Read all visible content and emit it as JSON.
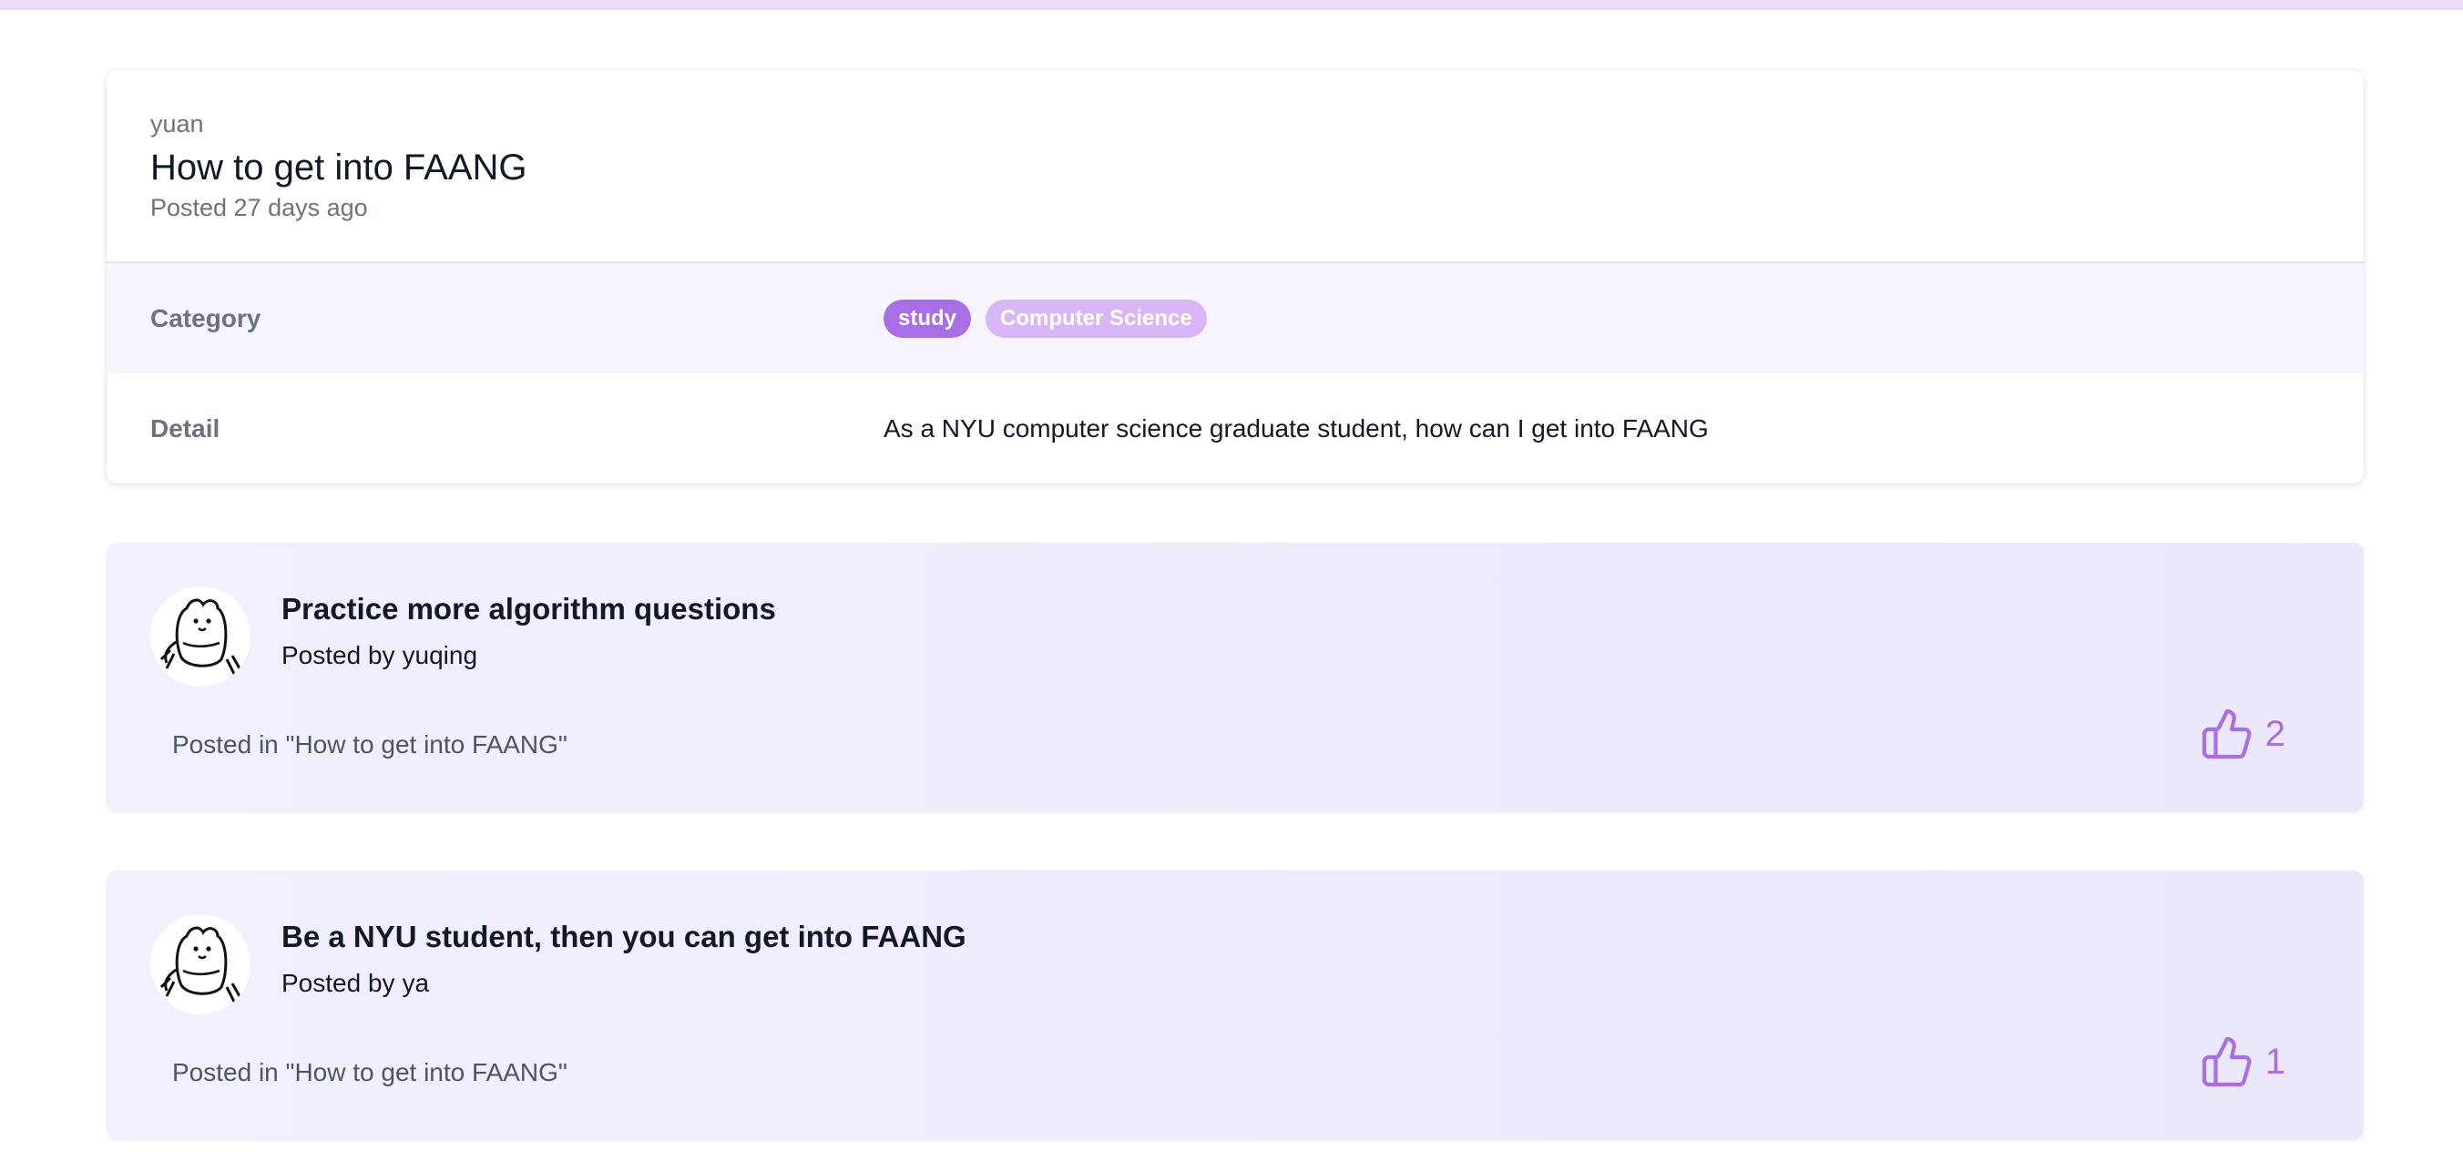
{
  "post": {
    "author": "yuan",
    "title": "How to get into FAANG",
    "posted": "Posted 27 days ago",
    "category_label": "Category",
    "tags": [
      "study",
      "Computer Science"
    ],
    "detail_label": "Detail",
    "detail": "As a NYU computer science graduate student, how can I get into FAANG"
  },
  "comments": [
    {
      "title": "Practice more algorithm questions",
      "by_label": "Posted by",
      "author": "yuqing",
      "posted_in": "Posted in \"How to get into FAANG\"",
      "likes": "2"
    },
    {
      "title": "Be a NYU student, then you can get into FAANG",
      "by_label": "Posted by",
      "author": "ya",
      "posted_in": "Posted in \"How to get into FAANG\"",
      "likes": "1"
    }
  ],
  "icons": {
    "like": "thumbs-up-icon",
    "avatar": "avatar-image"
  },
  "colors": {
    "accent": "#a86ee6",
    "accent_light": "#d9b7f6",
    "top_bar": "#e9dcfa",
    "comment_bg": "#f1edfd"
  }
}
